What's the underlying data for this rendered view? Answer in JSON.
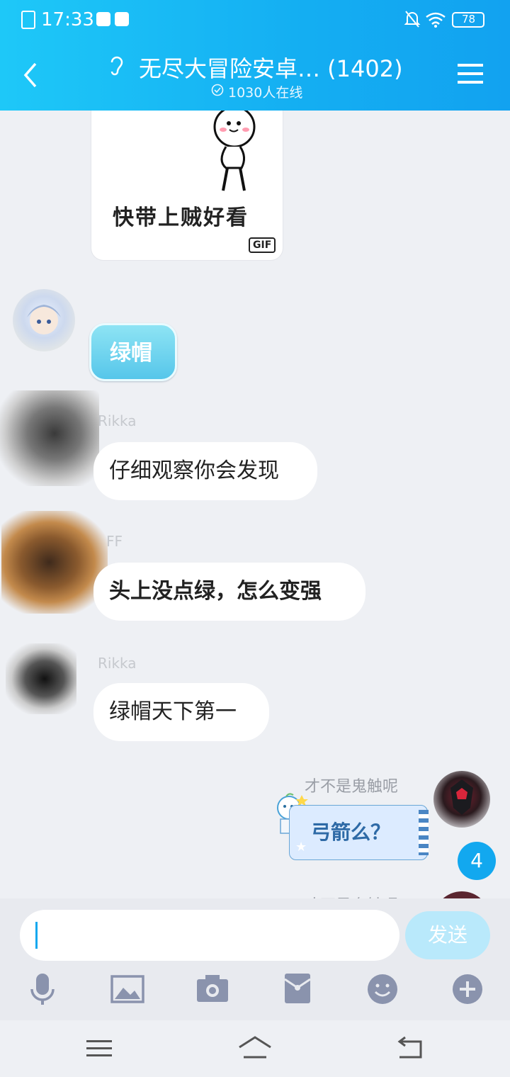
{
  "status_bar": {
    "time": "17:33",
    "battery": "78"
  },
  "header": {
    "title": "无尽大冒险安卓… (1402)",
    "online": "1030人在线"
  },
  "sticker": {
    "caption": "快带上贼好看",
    "badge": "GIF"
  },
  "messages": [
    {
      "sender": "",
      "text": "绿帽",
      "style": "blue-sticker"
    },
    {
      "sender": "Rikka",
      "text": "仔细观察你会发现"
    },
    {
      "sender": "FF",
      "text": "头上没点绿，怎么变强"
    },
    {
      "sender": "Rikka",
      "text": "绿帽天下第一"
    },
    {
      "sender": "才不是鬼触呢",
      "text": "弓箭么？",
      "mine": true
    },
    {
      "sender": "才不是鬼触呢",
      "mine": true
    }
  ],
  "unread_badge": "4",
  "input": {
    "value": "",
    "send_label": "发送"
  },
  "toolbar": [
    "mic-icon",
    "image-icon",
    "camera-icon",
    "red-packet-icon",
    "emoji-icon",
    "plus-icon"
  ],
  "colors": {
    "header_start": "#1ec8f8",
    "header_end": "#12a2f0",
    "send_button": "#b9e9fb",
    "tool_icon": "#8a93ad"
  }
}
